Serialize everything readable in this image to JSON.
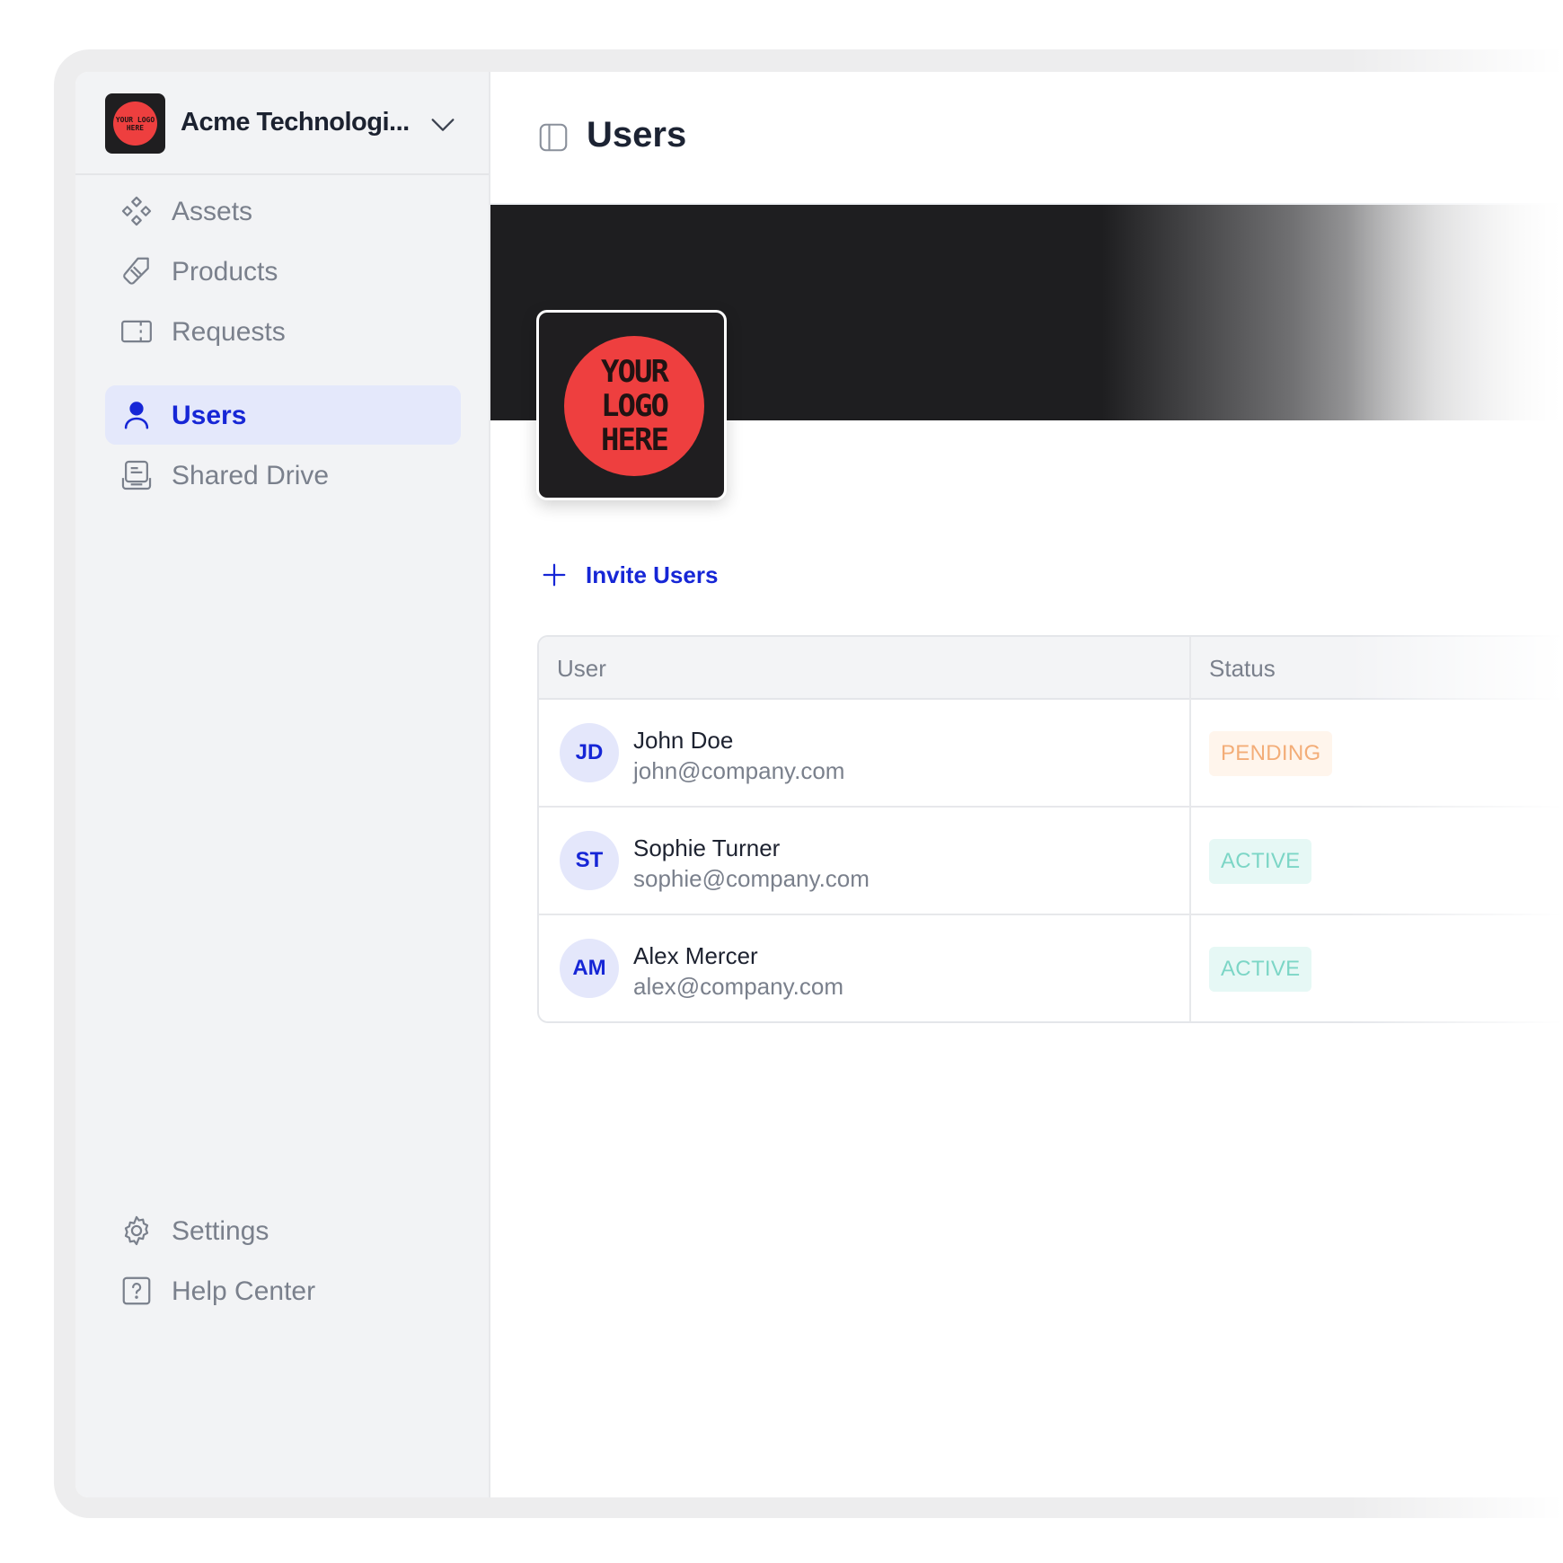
{
  "org": {
    "name": "Acme Technologi...",
    "logo_text": "YOUR LOGO HERE"
  },
  "sidebar": {
    "items": [
      {
        "label": "Assets",
        "icon": "assets-icon"
      },
      {
        "label": "Products",
        "icon": "tag-icon"
      },
      {
        "label": "Requests",
        "icon": "ticket-icon"
      },
      {
        "label": "Users",
        "icon": "user-icon",
        "active": true
      },
      {
        "label": "Shared Drive",
        "icon": "drive-icon"
      }
    ],
    "footer": [
      {
        "label": "Settings",
        "icon": "gear-icon"
      },
      {
        "label": "Help Center",
        "icon": "help-icon"
      }
    ]
  },
  "page": {
    "title": "Users",
    "invite_label": "Invite Users",
    "logo_text": [
      "YOUR",
      "LOGO",
      "HERE"
    ]
  },
  "table": {
    "columns": [
      "User",
      "Status"
    ],
    "rows": [
      {
        "initials": "JD",
        "name": "John Doe",
        "email": "john@company.com",
        "status": "PENDING"
      },
      {
        "initials": "ST",
        "name": "Sophie Turner",
        "email": "sophie@company.com",
        "status": "ACTIVE"
      },
      {
        "initials": "AM",
        "name": "Alex Mercer",
        "email": "alex@company.com",
        "status": "ACTIVE"
      }
    ]
  },
  "colors": {
    "accent": "#1626d6",
    "pending": "#f3ad78",
    "active": "#7cd6c6",
    "logo_red": "#ee3f3f"
  }
}
